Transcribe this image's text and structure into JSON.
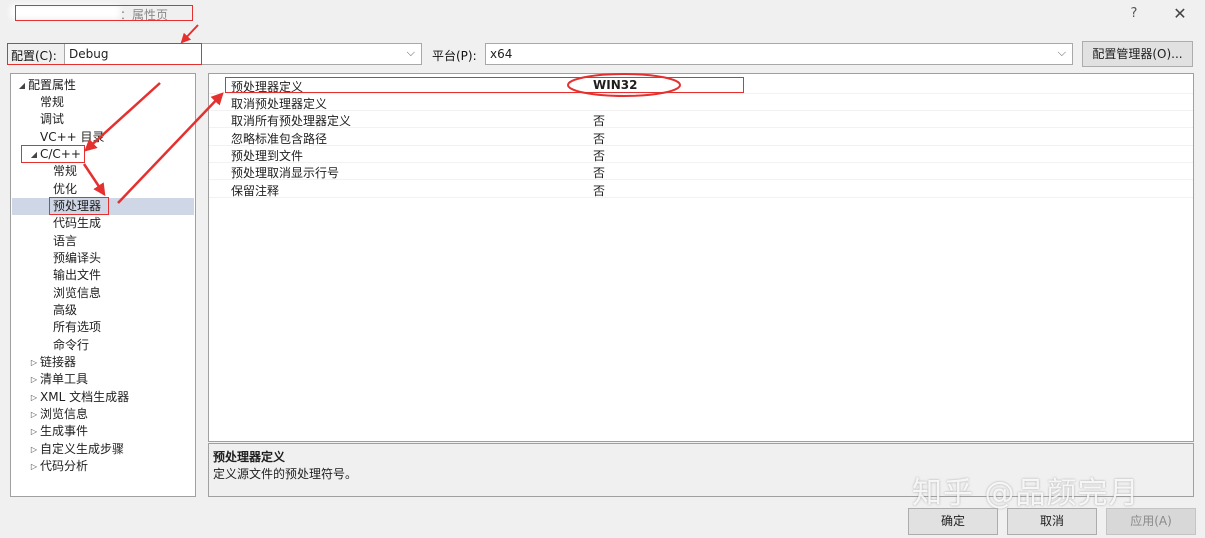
{
  "window": {
    "title_suffix": "：属性页",
    "help_glyph": "?",
    "close_glyph": "✕"
  },
  "config_row": {
    "config_label": "配置(C):",
    "config_value": "Debug",
    "platform_label": "平台(P):",
    "platform_value": "x64",
    "manager_button": "配置管理器(O)..."
  },
  "tree": {
    "root": "配置属性",
    "items": [
      {
        "label": "常规"
      },
      {
        "label": "调试"
      },
      {
        "label": "VC++ 目录"
      },
      {
        "label": "C/C++"
      },
      {
        "label": "常规"
      },
      {
        "label": "优化"
      },
      {
        "label": "预处理器"
      },
      {
        "label": "代码生成"
      },
      {
        "label": "语言"
      },
      {
        "label": "预编译头"
      },
      {
        "label": "输出文件"
      },
      {
        "label": "浏览信息"
      },
      {
        "label": "高级"
      },
      {
        "label": "所有选项"
      },
      {
        "label": "命令行"
      },
      {
        "label": "链接器"
      },
      {
        "label": "清单工具"
      },
      {
        "label": "XML 文档生成器"
      },
      {
        "label": "浏览信息"
      },
      {
        "label": "生成事件"
      },
      {
        "label": "自定义生成步骤"
      },
      {
        "label": "代码分析"
      }
    ],
    "expand_open": "◢",
    "expand_closed": "▷",
    "selected": "预处理器"
  },
  "grid": {
    "rows": [
      {
        "name": "预处理器定义",
        "value": "WIN32"
      },
      {
        "name": "取消预处理器定义",
        "value": ""
      },
      {
        "name": "取消所有预处理器定义",
        "value": "否"
      },
      {
        "name": "忽略标准包含路径",
        "value": "否"
      },
      {
        "name": "预处理到文件",
        "value": "否"
      },
      {
        "name": "预处理取消显示行号",
        "value": "否"
      },
      {
        "name": "保留注释",
        "value": "否"
      }
    ]
  },
  "description": {
    "title": "预处理器定义",
    "text": "定义源文件的预处理符号。"
  },
  "buttons": {
    "ok": "确定",
    "cancel": "取消",
    "apply": "应用(A)"
  },
  "watermark": "知乎 @品颜完月",
  "colors": {
    "annotation_red": "#e53030",
    "selection": "#cfd6e5",
    "dialog_bg": "#f0f0f0"
  }
}
